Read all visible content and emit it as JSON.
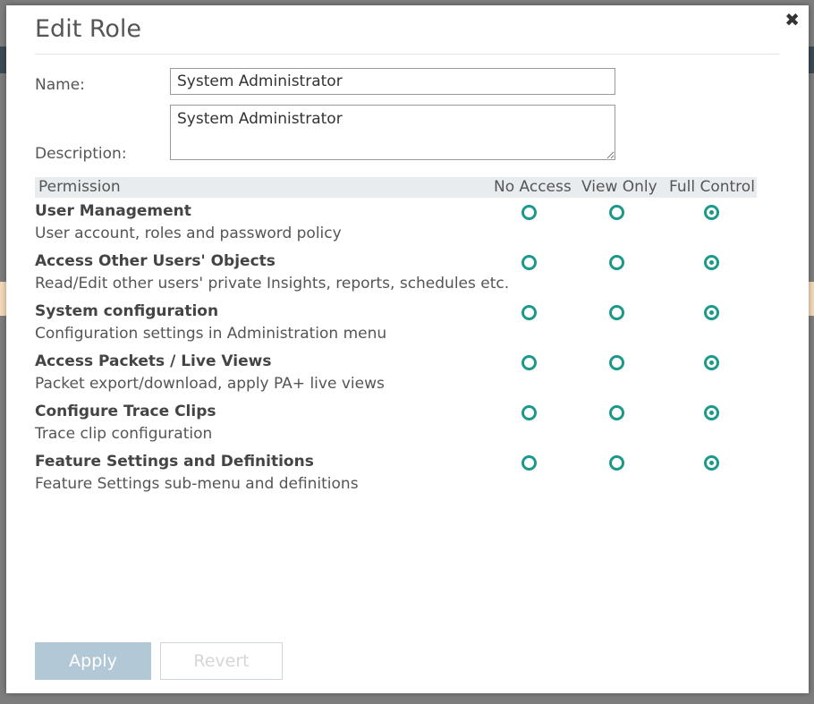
{
  "dialog": {
    "title": "Edit Role",
    "close_icon": "✖"
  },
  "form": {
    "name_label": "Name:",
    "name_value": "System Administrator",
    "description_label": "Description:",
    "description_value": "System Administrator"
  },
  "permissions": {
    "headers": {
      "permission": "Permission",
      "no_access": "No Access",
      "view_only": "View Only",
      "full_control": "Full Control"
    },
    "rows": [
      {
        "title": "User Management",
        "description": "User account, roles and password policy",
        "selected": "full_control"
      },
      {
        "title": "Access Other Users' Objects",
        "description": "Read/Edit other users' private Insights, reports, schedules etc.",
        "selected": "full_control"
      },
      {
        "title": "System configuration",
        "description": "Configuration settings in Administration menu",
        "selected": "full_control"
      },
      {
        "title": "Access Packets / Live Views",
        "description": "Packet export/download, apply PA+ live views",
        "selected": "full_control"
      },
      {
        "title": "Configure Trace Clips",
        "description": "Trace clip configuration",
        "selected": "full_control"
      },
      {
        "title": "Feature Settings and Definitions",
        "description": "Feature Settings sub-menu and definitions",
        "selected": "full_control"
      }
    ]
  },
  "buttons": {
    "apply": "Apply",
    "revert": "Revert"
  },
  "colors": {
    "radio_accent": "#1b9a8a",
    "apply_bg": "#b3c8d7"
  },
  "icons": {
    "close": "close-icon",
    "radio": "radio-button"
  }
}
